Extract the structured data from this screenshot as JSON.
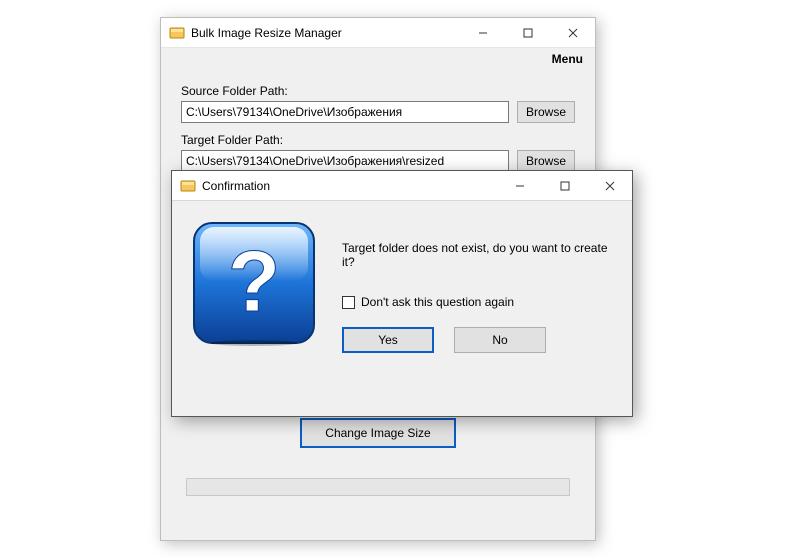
{
  "main": {
    "title": "Bulk Image Resize Manager",
    "menu": {
      "label": "Menu"
    },
    "source": {
      "label": "Source Folder Path:",
      "value": "C:\\Users\\79134\\OneDrive\\Изображения",
      "browse": "Browse"
    },
    "target": {
      "label": "Target Folder Path:",
      "value": "C:\\Users\\79134\\OneDrive\\Изображения\\resized",
      "browse": "Browse"
    },
    "primary_button": "Change Image Size"
  },
  "dialog": {
    "title": "Confirmation",
    "message": "Target folder does not exist, do you want to create it?",
    "checkbox_label": "Don't ask this question again",
    "yes": "Yes",
    "no": "No"
  }
}
